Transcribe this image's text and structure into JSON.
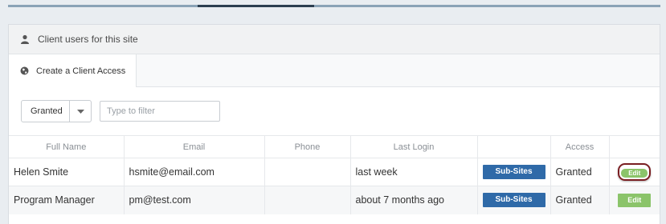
{
  "panel": {
    "title": "Client users for this site",
    "tab_label": "Create a Client Access"
  },
  "filter": {
    "selected": "Granted",
    "placeholder": "Type to filter"
  },
  "table": {
    "headers": [
      "Full Name",
      "Email",
      "Phone",
      "Last Login",
      "",
      "Access",
      ""
    ],
    "rows": [
      {
        "name": "Helen Smite",
        "email": "hsmite@email.com",
        "phone": "",
        "last_login": "last week",
        "subsites": "Sub-Sites",
        "access": "Granted",
        "edit": "Edit"
      },
      {
        "name": "Program Manager",
        "email": "pm@test.com",
        "phone": "",
        "last_login": "about 7 months ago",
        "subsites": "Sub-Sites",
        "access": "Granted",
        "edit": "Edit"
      }
    ]
  },
  "icons": {
    "heading": "user-icon",
    "tab": "globe-icon",
    "select": "caret-down-icon"
  },
  "colors": {
    "subsites_button": "#2f6aa8",
    "edit_button": "#8bc46a",
    "highlight": "#7a1e22"
  }
}
